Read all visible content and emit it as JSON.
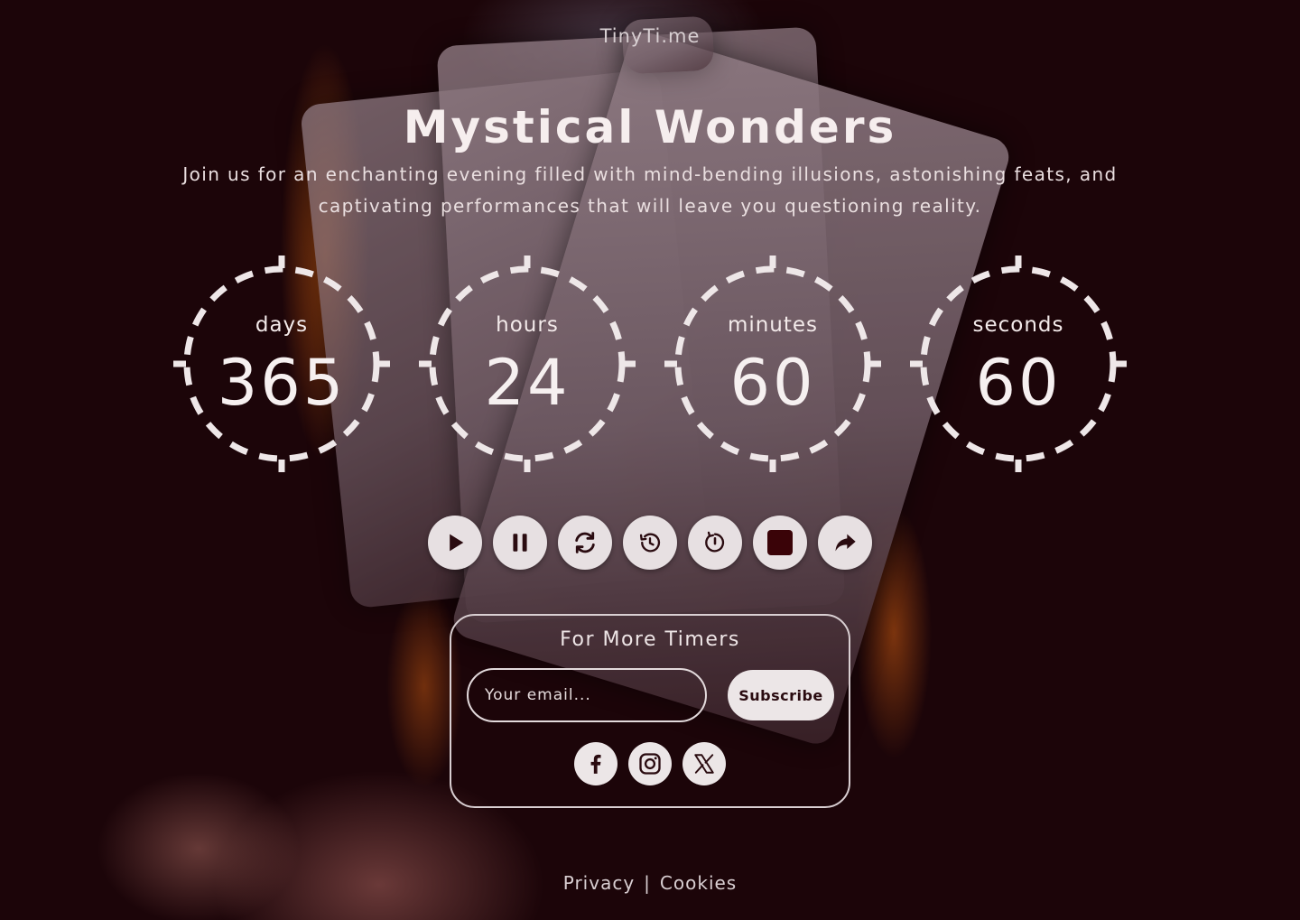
{
  "site": {
    "name": "TinyTi.me"
  },
  "event": {
    "title": "Mystical Wonders",
    "description": "Join us for an enchanting evening filled with mind-bending illusions, astonishing feats, and captivating performances that will leave you questioning reality."
  },
  "countdown": [
    {
      "label": "days",
      "value": "365"
    },
    {
      "label": "hours",
      "value": "24"
    },
    {
      "label": "minutes",
      "value": "60"
    },
    {
      "label": "seconds",
      "value": "60"
    }
  ],
  "controls": [
    {
      "icon": "play-icon"
    },
    {
      "icon": "pause-icon"
    },
    {
      "icon": "refresh-icon"
    },
    {
      "icon": "history-icon"
    },
    {
      "icon": "timer-reset-icon"
    },
    {
      "icon": "stop-icon"
    },
    {
      "icon": "share-icon"
    }
  ],
  "subscribe": {
    "title": "For More Timers",
    "email_placeholder": "Your email...",
    "button_label": "Subscribe"
  },
  "socials": [
    {
      "icon": "facebook-icon"
    },
    {
      "icon": "instagram-icon"
    },
    {
      "icon": "x-twitter-icon"
    }
  ],
  "footer": {
    "privacy": "Privacy",
    "separator": "|",
    "cookies": "Cookies"
  },
  "colors": {
    "background": "#1c0509",
    "button_bg": "#e7e0e2",
    "icon_dark": "#2a0b10",
    "stop_red": "#3a0308"
  }
}
